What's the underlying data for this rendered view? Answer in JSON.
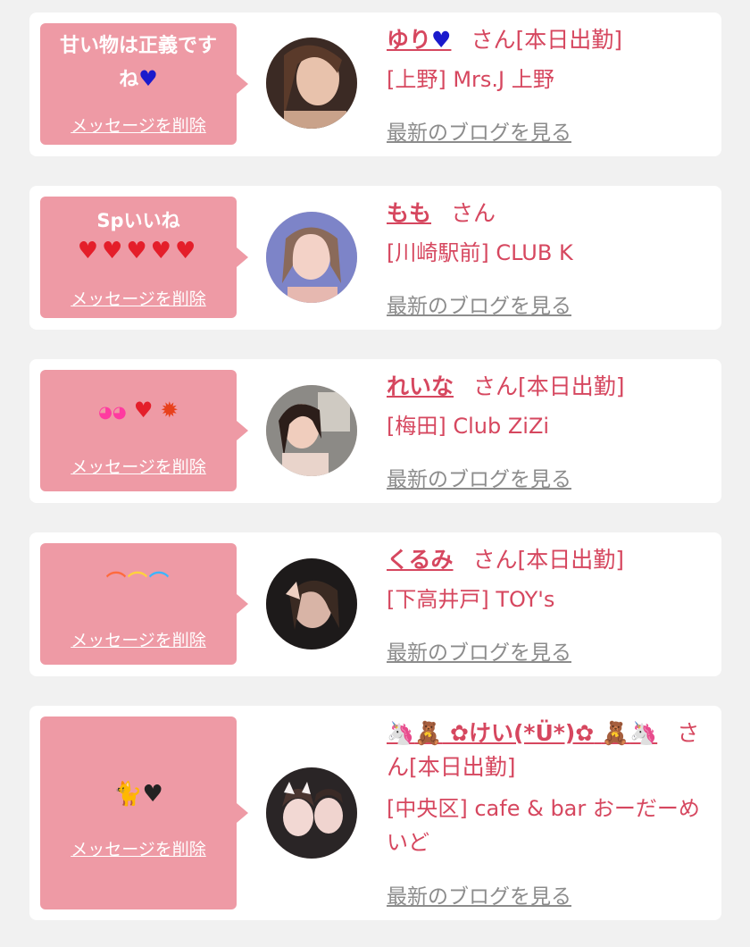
{
  "delete_label": "メッセージを削除",
  "blog_label": "最新のブログを見る",
  "cards": [
    {
      "message": "甘い物は正義です ね",
      "message_icon": "blue-heart",
      "name": "ゆり",
      "name_icon": "blue-heart",
      "san": "さん",
      "status": "[本日出勤]",
      "shop": "[上野] Mrs.J 上野"
    },
    {
      "message": "Spいいね",
      "message_icon": "red-hearts-x5",
      "name": "もも",
      "san": "さん",
      "status": "",
      "shop": "[川崎駅前] CLUB K"
    },
    {
      "message": "",
      "message_icon": "sparkle-eyes heart fire",
      "name": "れいな",
      "san": "さん",
      "status": "[本日出勤]",
      "shop": "[梅田] Club ZiZi"
    },
    {
      "message": "",
      "message_icon": "rainbow x3",
      "name": "くるみ",
      "san": "さん",
      "status": "[本日出勤]",
      "shop": "[下高井戸] TOY's"
    },
    {
      "message": "",
      "message_icon": "black-cat black-heart",
      "name": "✿けい(*Ü*)✿",
      "name_icons": "unicorn teddy-bear",
      "san": "さ",
      "san_rest": "ん",
      "status": "[本日出勤]",
      "shop": "[中央区] cafe & bar おーだーめいど"
    }
  ],
  "colors": {
    "background": "#f1f1f1",
    "card": "#ffffff",
    "bubble": "#ee9aa5",
    "accent": "#d6475f",
    "link_gray": "#8c8c8c"
  }
}
